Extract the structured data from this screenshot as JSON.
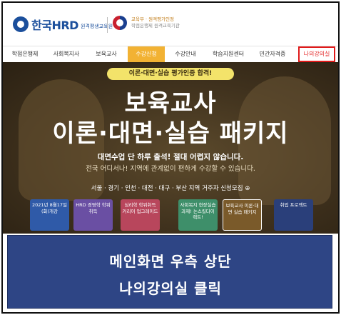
{
  "header": {
    "logo_text": "한국HRD",
    "logo_sub": "원격평생교육원",
    "gov_line1": "교육부 · 원격평가인정",
    "gov_line2": "학점은행제 원격교육기관"
  },
  "nav": {
    "items": [
      {
        "label": "학점은행제"
      },
      {
        "label": "사회복지사"
      },
      {
        "label": "보육교사"
      },
      {
        "label": "수강신청"
      },
      {
        "label": "수강안내"
      },
      {
        "label": "학습지원센터"
      },
      {
        "label": "민간자격증"
      },
      {
        "label": "나의강의실"
      }
    ],
    "active_index": 3,
    "highlighted_index": 7,
    "highlight_color": "#e01a1a",
    "active_color": "#f2b233"
  },
  "banner": {
    "pill": "이론·대면·실습 평가인증 합격!",
    "title_line1": "보육교사",
    "title_line2": "이론·대면·실습 패키지",
    "subtitle": "대면수업 단 하루 출석! 절대 어렵지 않습니다.",
    "subtitle2": "전국 어디서나! 지역에 관계없이 편하게 수강할 수 있습니다.",
    "regions": "서울 · 경기 · 인천 · 대전 · 대구 · 부산 지역 거주자 신청모집 ⊕",
    "cards": [
      {
        "text": "2021년 8월17일(화)개강",
        "color": "#2f5aa8"
      },
      {
        "text": "HRD 경영학 학위취득",
        "color": "#6a4fa3"
      },
      {
        "text": "심리학 학위취득 커리어 업그레이드",
        "color": "#b8465c"
      },
      {
        "text": "사회복지 현장실습과제! 논스킬다이렉트!",
        "color": "#3e8f6a"
      },
      {
        "text": "보육교사 이론·대면 실습 패키지",
        "color": "#7a5a2a"
      },
      {
        "text": "취업 프로젝트",
        "color": "#2a3f7a"
      }
    ],
    "selected_card": 4
  },
  "caption": {
    "line1": "메인화면 우측 상단",
    "line2": "나의강의실 클릭",
    "background": "#2e4585"
  }
}
